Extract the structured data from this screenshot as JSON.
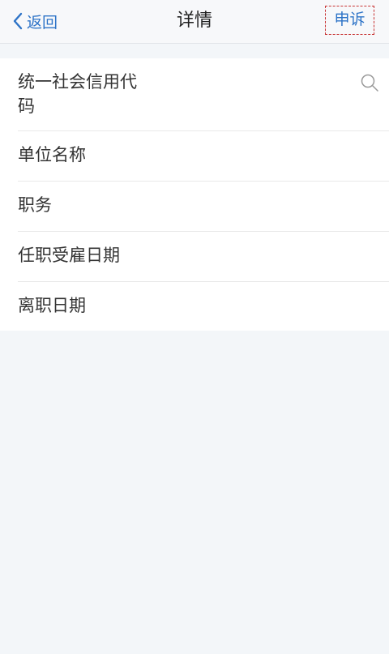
{
  "nav": {
    "back_label": "返回",
    "title": "详情",
    "appeal_label": "申诉"
  },
  "fields": [
    {
      "label": "统一社会信用代码"
    },
    {
      "label": "单位名称"
    },
    {
      "label": "职务"
    },
    {
      "label": "任职受雇日期"
    },
    {
      "label": "离职日期"
    }
  ],
  "icons": {
    "back": "chevron-left-icon",
    "search": "search-icon"
  },
  "colors": {
    "accent": "#2d73c7",
    "highlight_border": "#c83434",
    "background": "#f3f6f9"
  }
}
